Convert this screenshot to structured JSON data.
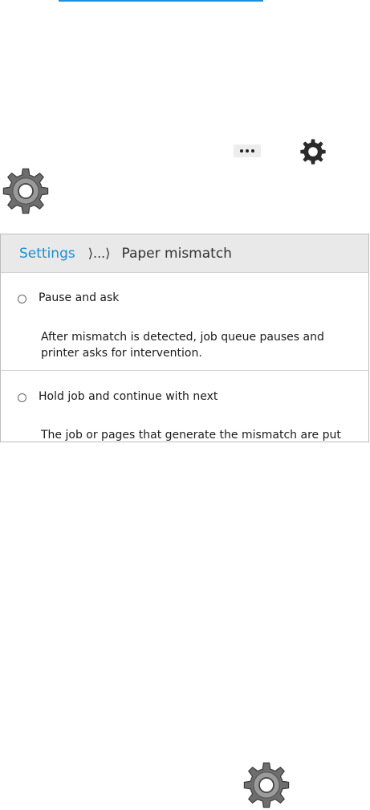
{
  "doc": {
    "icons": {
      "more": "ellipsis-icon",
      "settings": "gear-icon"
    }
  },
  "screen": {
    "breadcrumb": {
      "root": "Settings",
      "ellipsis": "⟩...⟩",
      "current": "Paper mismatch"
    },
    "options": [
      {
        "label": "Pause and ask",
        "description": "After mismatch is detected, job queue pauses and printer asks for intervention.",
        "selected": false
      },
      {
        "label": "Hold job and continue with next",
        "description": "The job or pages that generate the mismatch are put",
        "selected": false
      }
    ]
  }
}
